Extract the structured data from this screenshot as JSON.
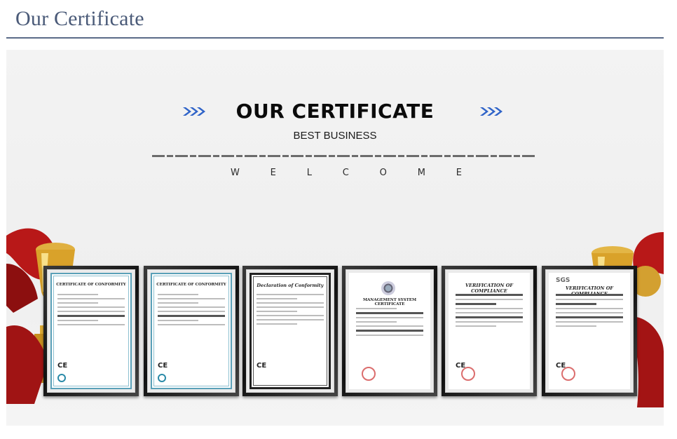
{
  "header": {
    "title": "Our Certificate"
  },
  "banner": {
    "title": "OUR CERTIFICATE",
    "subtitle": "BEST BUSINESS",
    "welcome_letters": [
      "W",
      "E",
      "L",
      "C",
      "O",
      "M",
      "E"
    ],
    "accent_color": "#2f63c8"
  },
  "certificates": [
    {
      "heading": "CERTIFICATE OF CONFORMITY",
      "style": "blue",
      "mark": "CE"
    },
    {
      "heading": "CERTIFICATE OF CONFORMITY",
      "style": "blue",
      "mark": "CE"
    },
    {
      "heading": "Declaration of Conformity",
      "style": "black",
      "mark": "CE"
    },
    {
      "heading": "MANAGEMENT SYSTEM CERTIFICATE",
      "style": "plain",
      "mark": ""
    },
    {
      "heading": "VERIFICATION OF COMPLIANCE",
      "style": "plain",
      "mark": "CE"
    },
    {
      "heading": "VERIFICATION OF COMPLIANCE",
      "style": "plain",
      "mark": "CE",
      "logo": "SGS"
    }
  ]
}
